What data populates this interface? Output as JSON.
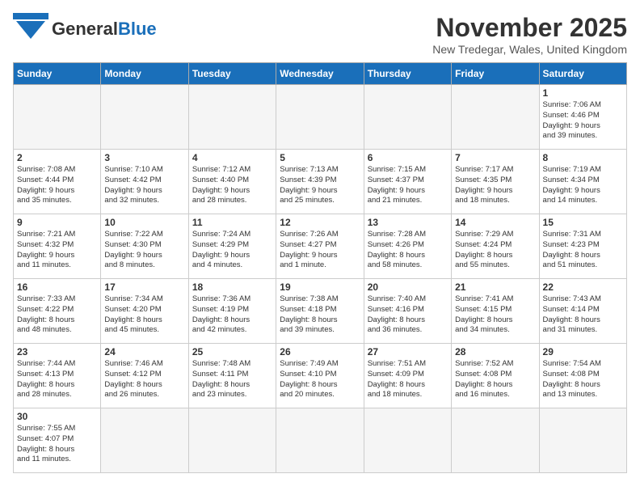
{
  "header": {
    "logo_general": "General",
    "logo_blue": "Blue",
    "month_title": "November 2025",
    "location": "New Tredegar, Wales, United Kingdom"
  },
  "weekdays": [
    "Sunday",
    "Monday",
    "Tuesday",
    "Wednesday",
    "Thursday",
    "Friday",
    "Saturday"
  ],
  "weeks": [
    [
      {
        "day": "",
        "info": ""
      },
      {
        "day": "",
        "info": ""
      },
      {
        "day": "",
        "info": ""
      },
      {
        "day": "",
        "info": ""
      },
      {
        "day": "",
        "info": ""
      },
      {
        "day": "",
        "info": ""
      },
      {
        "day": "1",
        "info": "Sunrise: 7:06 AM\nSunset: 4:46 PM\nDaylight: 9 hours\nand 39 minutes."
      }
    ],
    [
      {
        "day": "2",
        "info": "Sunrise: 7:08 AM\nSunset: 4:44 PM\nDaylight: 9 hours\nand 35 minutes."
      },
      {
        "day": "3",
        "info": "Sunrise: 7:10 AM\nSunset: 4:42 PM\nDaylight: 9 hours\nand 32 minutes."
      },
      {
        "day": "4",
        "info": "Sunrise: 7:12 AM\nSunset: 4:40 PM\nDaylight: 9 hours\nand 28 minutes."
      },
      {
        "day": "5",
        "info": "Sunrise: 7:13 AM\nSunset: 4:39 PM\nDaylight: 9 hours\nand 25 minutes."
      },
      {
        "day": "6",
        "info": "Sunrise: 7:15 AM\nSunset: 4:37 PM\nDaylight: 9 hours\nand 21 minutes."
      },
      {
        "day": "7",
        "info": "Sunrise: 7:17 AM\nSunset: 4:35 PM\nDaylight: 9 hours\nand 18 minutes."
      },
      {
        "day": "8",
        "info": "Sunrise: 7:19 AM\nSunset: 4:34 PM\nDaylight: 9 hours\nand 14 minutes."
      }
    ],
    [
      {
        "day": "9",
        "info": "Sunrise: 7:21 AM\nSunset: 4:32 PM\nDaylight: 9 hours\nand 11 minutes."
      },
      {
        "day": "10",
        "info": "Sunrise: 7:22 AM\nSunset: 4:30 PM\nDaylight: 9 hours\nand 8 minutes."
      },
      {
        "day": "11",
        "info": "Sunrise: 7:24 AM\nSunset: 4:29 PM\nDaylight: 9 hours\nand 4 minutes."
      },
      {
        "day": "12",
        "info": "Sunrise: 7:26 AM\nSunset: 4:27 PM\nDaylight: 9 hours\nand 1 minute."
      },
      {
        "day": "13",
        "info": "Sunrise: 7:28 AM\nSunset: 4:26 PM\nDaylight: 8 hours\nand 58 minutes."
      },
      {
        "day": "14",
        "info": "Sunrise: 7:29 AM\nSunset: 4:24 PM\nDaylight: 8 hours\nand 55 minutes."
      },
      {
        "day": "15",
        "info": "Sunrise: 7:31 AM\nSunset: 4:23 PM\nDaylight: 8 hours\nand 51 minutes."
      }
    ],
    [
      {
        "day": "16",
        "info": "Sunrise: 7:33 AM\nSunset: 4:22 PM\nDaylight: 8 hours\nand 48 minutes."
      },
      {
        "day": "17",
        "info": "Sunrise: 7:34 AM\nSunset: 4:20 PM\nDaylight: 8 hours\nand 45 minutes."
      },
      {
        "day": "18",
        "info": "Sunrise: 7:36 AM\nSunset: 4:19 PM\nDaylight: 8 hours\nand 42 minutes."
      },
      {
        "day": "19",
        "info": "Sunrise: 7:38 AM\nSunset: 4:18 PM\nDaylight: 8 hours\nand 39 minutes."
      },
      {
        "day": "20",
        "info": "Sunrise: 7:40 AM\nSunset: 4:16 PM\nDaylight: 8 hours\nand 36 minutes."
      },
      {
        "day": "21",
        "info": "Sunrise: 7:41 AM\nSunset: 4:15 PM\nDaylight: 8 hours\nand 34 minutes."
      },
      {
        "day": "22",
        "info": "Sunrise: 7:43 AM\nSunset: 4:14 PM\nDaylight: 8 hours\nand 31 minutes."
      }
    ],
    [
      {
        "day": "23",
        "info": "Sunrise: 7:44 AM\nSunset: 4:13 PM\nDaylight: 8 hours\nand 28 minutes."
      },
      {
        "day": "24",
        "info": "Sunrise: 7:46 AM\nSunset: 4:12 PM\nDaylight: 8 hours\nand 26 minutes."
      },
      {
        "day": "25",
        "info": "Sunrise: 7:48 AM\nSunset: 4:11 PM\nDaylight: 8 hours\nand 23 minutes."
      },
      {
        "day": "26",
        "info": "Sunrise: 7:49 AM\nSunset: 4:10 PM\nDaylight: 8 hours\nand 20 minutes."
      },
      {
        "day": "27",
        "info": "Sunrise: 7:51 AM\nSunset: 4:09 PM\nDaylight: 8 hours\nand 18 minutes."
      },
      {
        "day": "28",
        "info": "Sunrise: 7:52 AM\nSunset: 4:08 PM\nDaylight: 8 hours\nand 16 minutes."
      },
      {
        "day": "29",
        "info": "Sunrise: 7:54 AM\nSunset: 4:08 PM\nDaylight: 8 hours\nand 13 minutes."
      }
    ],
    [
      {
        "day": "30",
        "info": "Sunrise: 7:55 AM\nSunset: 4:07 PM\nDaylight: 8 hours\nand 11 minutes."
      },
      {
        "day": "",
        "info": ""
      },
      {
        "day": "",
        "info": ""
      },
      {
        "day": "",
        "info": ""
      },
      {
        "day": "",
        "info": ""
      },
      {
        "day": "",
        "info": ""
      },
      {
        "day": "",
        "info": ""
      }
    ]
  ]
}
